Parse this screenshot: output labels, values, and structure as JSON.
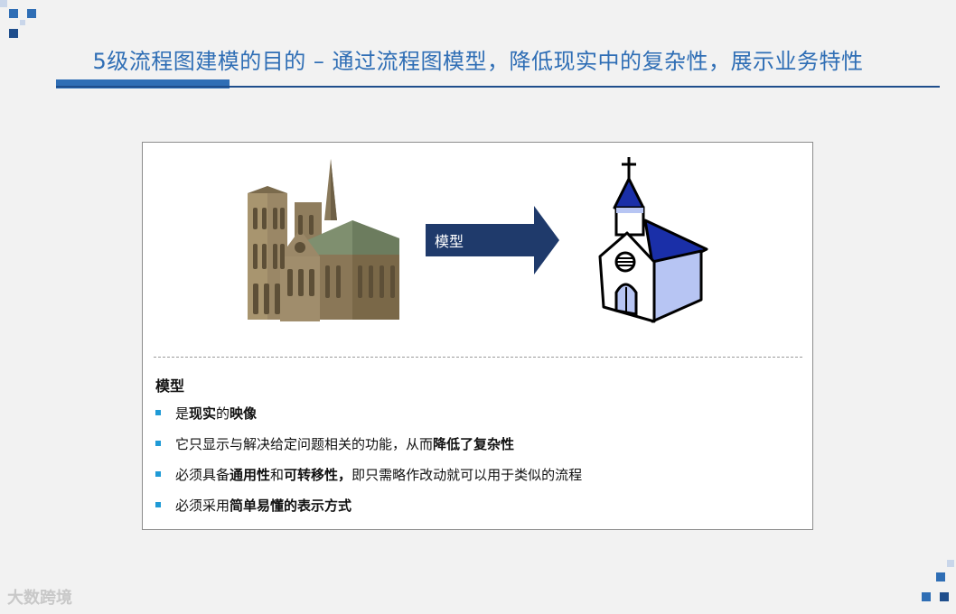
{
  "title": "5级流程图建模的目的 – 通过流程图模型，降低现实中的复杂性，展示业务特性",
  "arrow_label": "模型",
  "section_heading": "模型",
  "bullets": [
    {
      "parts": [
        {
          "t": "是"
        },
        {
          "t": "现实",
          "b": true
        },
        {
          "t": "的"
        },
        {
          "t": "映像",
          "b": true
        }
      ]
    },
    {
      "parts": [
        {
          "t": "它只显示与解决给定问题相关的功能，从而"
        },
        {
          "t": "降低了复杂性",
          "b": true
        }
      ]
    },
    {
      "parts": [
        {
          "t": "必须具备"
        },
        {
          "t": "通用性",
          "b": true
        },
        {
          "t": "和"
        },
        {
          "t": "可转移性，",
          "b": true
        },
        {
          "t": "即只需略作改动就可以用于类似的流程"
        }
      ]
    },
    {
      "parts": [
        {
          "t": "必须采用"
        },
        {
          "t": "简单易懂的表示方式",
          "b": true
        }
      ]
    }
  ],
  "watermark": "大数跨境",
  "images": {
    "left": "cathedral-picture",
    "right": "chapel-icon"
  },
  "colors": {
    "title": "#2f6eb5",
    "arrow": "#1f3a6b",
    "bullet": "#1f9ad6",
    "chapel_roof": "#1a2fa8",
    "chapel_wall": "#b7c5f3"
  }
}
